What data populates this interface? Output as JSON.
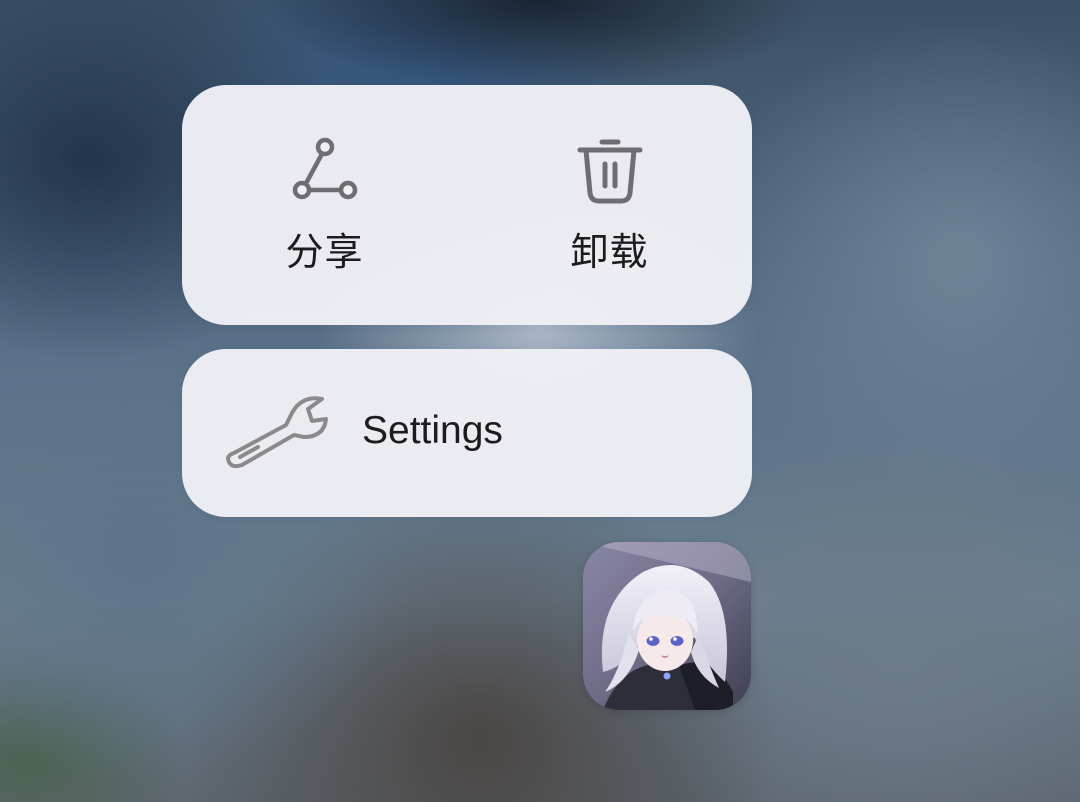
{
  "context_menu": {
    "quick_actions": [
      {
        "label": "分享",
        "icon": "share-icon"
      },
      {
        "label": "卸载",
        "icon": "trash-icon"
      }
    ],
    "shortcuts": [
      {
        "label": "Settings",
        "icon": "wrench-icon"
      }
    ]
  },
  "app": {
    "icon": "anime-character-app-icon"
  },
  "colors": {
    "card_background": "#f0f0f6",
    "icon_stroke": "#6e6e72",
    "text": "#1c1c1e"
  }
}
